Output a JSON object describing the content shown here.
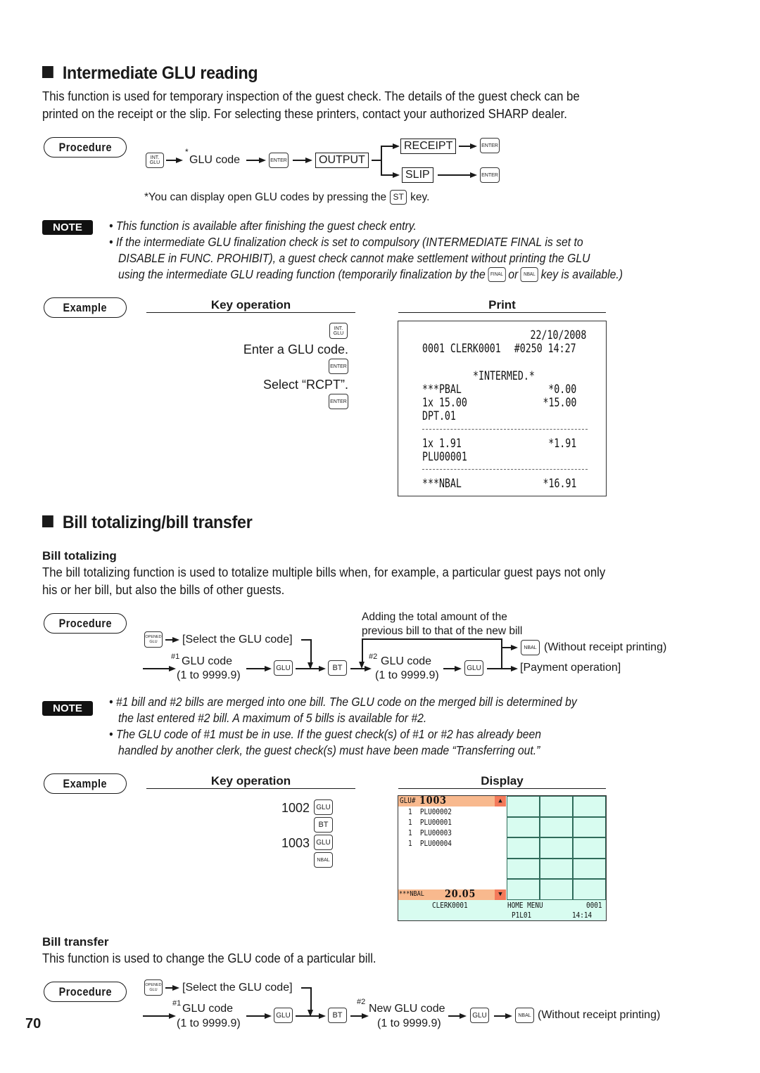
{
  "page_number": "70",
  "section1": {
    "title": "Intermediate GLU reading",
    "intro_lines": [
      "This function is used for temporary inspection of the guest check. The details of the guest check can be",
      "printed on the receipt or the slip. For selecting these printers, contact your authorized SHARP dealer."
    ],
    "procedure": {
      "badge": "Procedure",
      "key_int_glu": "INT. GLU",
      "glu_code_label": "GLU code",
      "asterisk": "*",
      "key_enter": "ENTER",
      "output_box": "OUTPUT",
      "receipt_box": "RECEIPT",
      "slip_box": "SLIP",
      "footnote_prefix": "*You can display open GLU codes by pressing the",
      "footnote_key": "ST",
      "footnote_suffix": "key."
    },
    "note": {
      "badge": "NOTE",
      "lines": [
        "• This function is available after finishing the guest check entry.",
        "• If the intermediate GLU finalization check is set to compulsory (INTERMEDIATE FINAL is set to",
        "DISABLE in FUNC. PROHIBIT), a guest check cannot make settlement without printing the GLU"
      ],
      "last_line_prefix": "using the intermediate GLU reading function (temporarily finalization by the",
      "key_final": "FINAL",
      "or": "or",
      "key_nbal": "NBAL",
      "last_line_suffix": "key is available.)"
    },
    "example": {
      "badge": "Example",
      "key_operation_header": "Key operation",
      "print_header": "Print",
      "steps": [
        {
          "type": "key",
          "value": "INT. GLU"
        },
        {
          "type": "text",
          "value": "Enter a GLU code."
        },
        {
          "type": "key",
          "value": "ENTER"
        },
        {
          "type": "text",
          "value": "Select “RCPT”."
        },
        {
          "type": "key",
          "value": "ENTER"
        }
      ],
      "receipt": {
        "date": "22/10/2008",
        "header_left": "0001 CLERK0001",
        "header_right": "#0250 14:27",
        "title": "*INTERMED.*",
        "pbal_label": "***PBAL",
        "pbal_value": "*0.00",
        "line1_qty": "1x 15.00",
        "line1_value": "*15.00",
        "line1_name": "DPT.01",
        "line2_qty": "1x 1.91",
        "line2_value": "*1.91",
        "line2_name": "PLU00001",
        "nbal_label": "***NBAL",
        "nbal_value": "*16.91"
      }
    }
  },
  "section2": {
    "title": "Bill totalizing/bill transfer",
    "bill_totalizing": {
      "heading": "Bill totalizing",
      "intro_lines": [
        "The bill totalizing function is used to totalize multiple bills when, for example, a particular guest pays not only",
        "his or her bill, but also the bills of other guests."
      ],
      "procedure": {
        "badge": "Procedure",
        "key_opened_glu": "OPENED GLU",
        "select_glu": "[Select the GLU code]",
        "code1_sup": "#1",
        "code1_label": "GLU code",
        "code1_range": "(1 to 9999.9)",
        "key_glu": "GLU",
        "key_bt": "BT",
        "loop_note_lines": [
          "Adding the total amount of the",
          "previous bill to that of the new bill"
        ],
        "code2_sup": "#2",
        "code2_label": "GLU code",
        "code2_range": "(1 to 9999.9)",
        "key_nbal": "NBAL",
        "without_receipt": "(Without receipt printing)",
        "payment_operation": "[Payment operation]"
      },
      "note": {
        "badge": "NOTE",
        "lines": [
          "• #1 bill and #2 bills are merged into one bill. The GLU code on the merged bill is determined by",
          "the last entered #2 bill.  A maximum of 5 bills is available for #2.",
          "• The GLU code of #1 must be in use.  If the guest check(s) of #1 or #2 has already been",
          "handled by another clerk, the guest check(s) must have been made “Transferring out.”"
        ]
      },
      "example": {
        "badge": "Example",
        "key_operation_header": "Key operation",
        "display_header": "Display",
        "steps": [
          {
            "number": "1002",
            "key": "GLU"
          },
          {
            "number": "",
            "key": "BT"
          },
          {
            "number": "1003",
            "key": "GLU"
          },
          {
            "number": "",
            "key": "NBAL"
          }
        ],
        "display": {
          "glu_label": "GLU#",
          "glu_number": "1003",
          "items": [
            {
              "qty": "1",
              "name": "PLU00002"
            },
            {
              "qty": "1",
              "name": "PLU00001"
            },
            {
              "qty": "1",
              "name": "PLU00003"
            },
            {
              "qty": "1",
              "name": "PLU00004"
            }
          ],
          "nbal_label": "***NBAL",
          "nbal_value": "20.05",
          "clerk": "CLERK0001",
          "menu": "HOME MENU",
          "machine": "0001",
          "page": "P1L01",
          "time": "14:14",
          "colors": {
            "header_bar": "#f8b98e",
            "scroll_btn": "#f47a5a",
            "keypad_bg": "#d8fcf0",
            "grid_line": "#2f6b5a"
          }
        }
      }
    },
    "bill_transfer": {
      "heading": "Bill transfer",
      "intro": "This function is used to change the GLU code of a particular bill.",
      "procedure": {
        "badge": "Procedure",
        "key_opened_glu": "OPENED GLU",
        "select_glu": "[Select the GLU code]",
        "code1_sup": "#1",
        "code1_label": "GLU code",
        "code1_range": "(1 to 9999.9)",
        "key_glu": "GLU",
        "key_bt": "BT",
        "code2_sup": "#2",
        "code2_label": "New GLU code",
        "code2_range": "(1 to 9999.9)",
        "key_glu2": "GLU",
        "key_nbal": "NBAL",
        "without_receipt": "(Without receipt printing)"
      }
    }
  }
}
